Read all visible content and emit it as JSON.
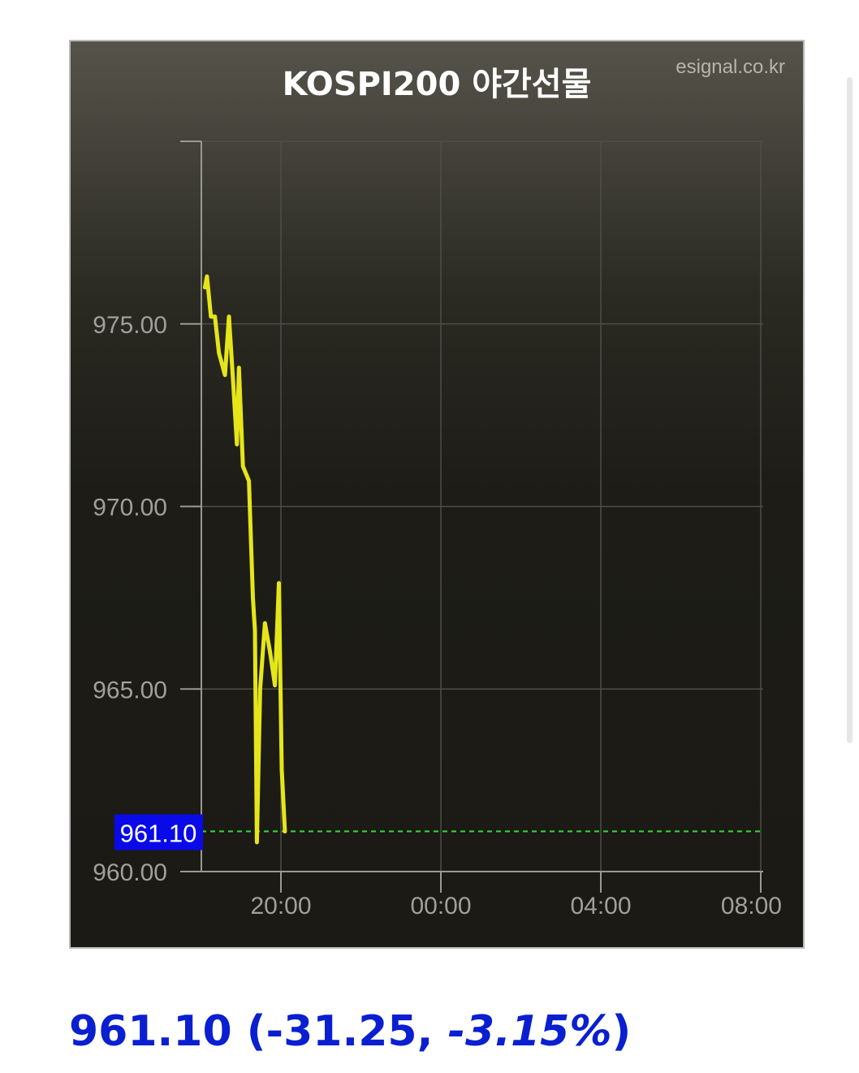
{
  "chart_data": {
    "type": "line",
    "title": "KOSPI200 야간선물",
    "source": "esignal.co.kr",
    "x_ticks": [
      "20:00",
      "00:00",
      "04:00",
      "08:00"
    ],
    "y_ticks": [
      "960.00",
      "965.00",
      "970.00",
      "975.00"
    ],
    "ylim": [
      960,
      980
    ],
    "xlim_hours": [
      18,
      32
    ],
    "grid": true,
    "series": [
      {
        "color": "#e5e51a",
        "x_hours": [
          18.1,
          18.15,
          18.25,
          18.35,
          18.45,
          18.6,
          18.7,
          18.8,
          18.9,
          18.95,
          19.05,
          19.2,
          19.3,
          19.35,
          19.4,
          19.48,
          19.6,
          19.73,
          19.85,
          19.95,
          20.02,
          20.1
        ],
        "values": [
          976.0,
          976.3,
          975.2,
          975.2,
          974.2,
          973.6,
          975.2,
          973.5,
          971.7,
          973.8,
          971.1,
          970.7,
          967.5,
          966.6,
          960.8,
          965.0,
          966.8,
          966.0,
          965.1,
          967.9,
          962.8,
          961.1
        ]
      }
    ],
    "reference_line": {
      "value": 961.1,
      "label": "961.10",
      "color": "#33dd33",
      "style": "dashed"
    }
  },
  "colors": {
    "line": "#e5e51a",
    "reference": "#33dd33",
    "label_bg": "#0a0ae8",
    "quote": "#0a1fd0"
  },
  "quote": {
    "price": "961.10",
    "change_prefix": "(-31.25, ",
    "change_pct": "-3.15%",
    "suffix": ")"
  }
}
